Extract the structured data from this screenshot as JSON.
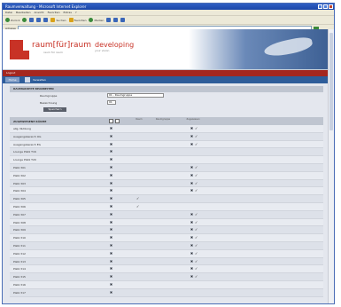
{
  "window": {
    "title": "Raumverwaltung - Microsoft Internet Explorer",
    "menu": [
      "Datei",
      "Bearbeiten",
      "Ansicht",
      "Favoriten",
      "Extras",
      "?"
    ],
    "toolbar": {
      "back": "Zurück",
      "search": "Suchen",
      "favorites": "Favoriten",
      "media": "Medien"
    },
    "address_label": "Adresse"
  },
  "banner": {
    "logo": "raum[für]raum",
    "logo_sub": "raum für raum",
    "brand": "developing",
    "brand_sub": "your vision"
  },
  "userbar": {
    "label": "Logout"
  },
  "nav": {
    "home": "Home",
    "link": "Verwalten"
  },
  "form": {
    "section_title": "RAUMGRUPPE BEARBEITEN",
    "group_label": "Raumgruppe",
    "group_value": "01 - Raumgruppe",
    "description_label": "Bezeichnung",
    "description_value": "01",
    "save_button": "Speichern"
  },
  "table": {
    "header": "ZUGEWIESENE RÄUME",
    "columns": [
      "Raum",
      "Raumgruppe",
      "Zugewiesen"
    ],
    "rows": [
      {
        "name": "allg. Nutzung",
        "a": true,
        "b": false,
        "c": true
      },
      {
        "name": "Ausgangsbereich OG",
        "a": true,
        "b": false,
        "c": true
      },
      {
        "name": "Ausgangsbereich EG",
        "a": true,
        "b": false,
        "c": true
      },
      {
        "name": "Lounge Platz T16",
        "a": true,
        "b": false,
        "c": false
      },
      {
        "name": "Lounge Platz T20",
        "a": true,
        "b": false,
        "c": false
      },
      {
        "name": "Platz 301",
        "a": true,
        "b": false,
        "c": true
      },
      {
        "name": "Platz 302",
        "a": true,
        "b": false,
        "c": true
      },
      {
        "name": "Platz 303",
        "a": true,
        "b": false,
        "c": true
      },
      {
        "name": "Platz 304",
        "a": true,
        "b": false,
        "c": true
      },
      {
        "name": "Platz 305",
        "a": true,
        "b": true,
        "c": false
      },
      {
        "name": "Platz 306",
        "a": true,
        "b": true,
        "c": false
      },
      {
        "name": "Platz 307",
        "a": true,
        "b": false,
        "c": true
      },
      {
        "name": "Platz 308",
        "a": true,
        "b": false,
        "c": true
      },
      {
        "name": "Platz 309",
        "a": true,
        "b": false,
        "c": true
      },
      {
        "name": "Platz 310",
        "a": true,
        "b": false,
        "c": true
      },
      {
        "name": "Platz 311",
        "a": true,
        "b": false,
        "c": true
      },
      {
        "name": "Platz 312",
        "a": true,
        "b": false,
        "c": true
      },
      {
        "name": "Platz 313",
        "a": true,
        "b": false,
        "c": true
      },
      {
        "name": "Platz 314",
        "a": true,
        "b": false,
        "c": true
      },
      {
        "name": "Platz 315",
        "a": true,
        "b": false,
        "c": true
      },
      {
        "name": "Platz 316",
        "a": true,
        "b": false,
        "c": false
      },
      {
        "name": "Platz 317",
        "a": true,
        "b": false,
        "c": false
      }
    ]
  },
  "colors": {
    "brand_red": "#c83226",
    "nav_blue": "#2e5d9a",
    "header_gray": "#bfc5d0"
  }
}
